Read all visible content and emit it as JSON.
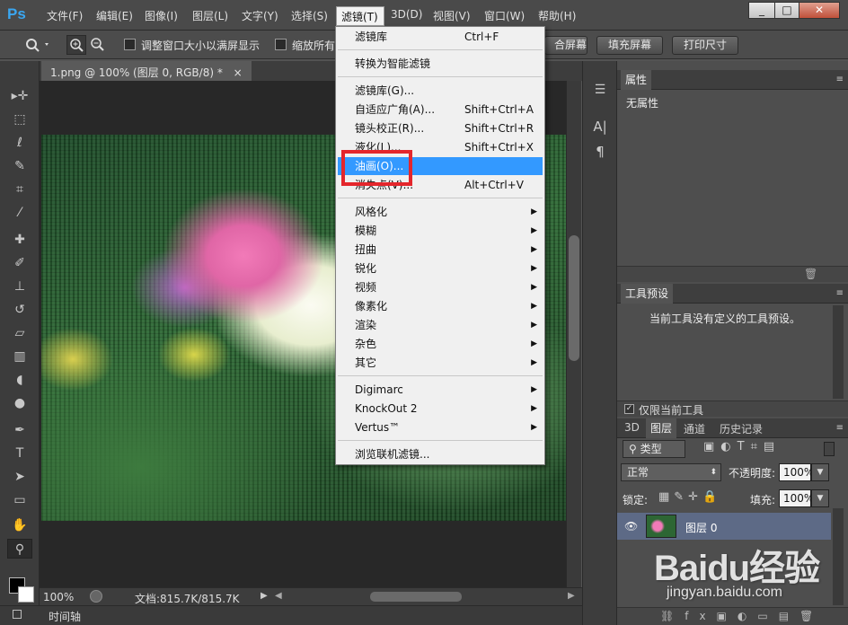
{
  "app": {
    "logo": "Ps"
  },
  "menubar": {
    "items": [
      "文件(F)",
      "编辑(E)",
      "图像(I)",
      "图层(L)",
      "文字(Y)",
      "选择(S)",
      "滤镜(T)",
      "3D(D)",
      "视图(V)",
      "窗口(W)",
      "帮助(H)"
    ],
    "active": "滤镜(T)"
  },
  "window_controls": {
    "minimize": "_",
    "maximize": "□",
    "close": "✕"
  },
  "options_bar": {
    "resize_windows": "调整窗口大小以满屏显示",
    "zoom_all": "缩放所有",
    "fit_screen_partial": "合屏幕",
    "fill_screen": "填充屏幕",
    "print_size": "打印尺寸"
  },
  "document": {
    "tab_title": "1.png @ 100% (图层 0, RGB/8) *",
    "tab_close": "×",
    "zoom": "100%",
    "doc_info": "文档:815.7K/815.7K"
  },
  "timeline": {
    "label": "时间轴"
  },
  "filter_menu": {
    "groups": [
      [
        {
          "label": "滤镜库",
          "shortcut": "Ctrl+F"
        }
      ],
      [
        {
          "label": "转换为智能滤镜"
        }
      ],
      [
        {
          "label": "滤镜库(G)..."
        },
        {
          "label": "自适应广角(A)...",
          "shortcut": "Shift+Ctrl+A"
        },
        {
          "label": "镜头校正(R)...",
          "shortcut": "Shift+Ctrl+R"
        },
        {
          "label": "液化(L)...",
          "shortcut": "Shift+Ctrl+X"
        },
        {
          "label": "油画(O)...",
          "highlighted": true
        },
        {
          "label": "消失点(V)...",
          "shortcut": "Alt+Ctrl+V"
        }
      ],
      [
        {
          "label": "风格化",
          "submenu": true
        },
        {
          "label": "模糊",
          "submenu": true
        },
        {
          "label": "扭曲",
          "submenu": true
        },
        {
          "label": "锐化",
          "submenu": true
        },
        {
          "label": "视频",
          "submenu": true
        },
        {
          "label": "像素化",
          "submenu": true
        },
        {
          "label": "渲染",
          "submenu": true
        },
        {
          "label": "杂色",
          "submenu": true
        },
        {
          "label": "其它",
          "submenu": true
        }
      ],
      [
        {
          "label": "Digimarc",
          "submenu": true
        },
        {
          "label": "KnockOut 2",
          "submenu": true
        },
        {
          "label": "Vertus™",
          "submenu": true
        }
      ],
      [
        {
          "label": "浏览联机滤镜..."
        }
      ]
    ]
  },
  "properties_panel": {
    "tab": "属性",
    "content": "无属性"
  },
  "tool_presets_panel": {
    "tab": "工具预设",
    "message": "当前工具没有定义的工具预设。",
    "current_tool_only": "仅限当前工具"
  },
  "layers_panel": {
    "tabs": [
      "3D",
      "图层",
      "通道",
      "历史记录"
    ],
    "active_tab": "图层",
    "filter_kind": "类型",
    "blend_mode": "正常",
    "opacity_label": "不透明度:",
    "opacity_value": "100%",
    "lock_label": "锁定:",
    "fill_label": "填充:",
    "fill_value": "100%",
    "layers": [
      {
        "name": "图层 0",
        "visible": true
      }
    ]
  },
  "watermark": {
    "brand": "Baidu经验",
    "url": "jingyan.baidu.com"
  },
  "colors": {
    "highlight": "#3399ff",
    "annotation_box": "#e4262c",
    "ps_logo": "#3aa6f0"
  }
}
